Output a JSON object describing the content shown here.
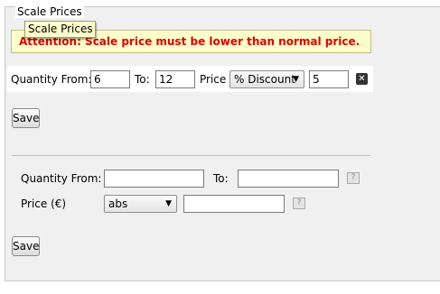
{
  "fieldset": {
    "legend": "Scale Prices"
  },
  "tooltip": {
    "text": "Scale Prices"
  },
  "alert": {
    "text": "Attention: Scale price must be lower than normal price."
  },
  "existing_row": {
    "quantity_from_label": "Quantity From:",
    "quantity_from_value": "6",
    "to_label": "To:",
    "to_value": "12",
    "price_label": "Price",
    "price_type_selected": "% Discount",
    "price_value": "5",
    "delete_icon": "close-icon"
  },
  "save_label": "Save",
  "new_entry": {
    "quantity_from_label": "Quantity From:",
    "quantity_from_value": "",
    "to_label": "To:",
    "to_value": "",
    "price_label": "Price (€)",
    "price_type_selected": "abs",
    "price_value": "",
    "help_icon_glyph": "?"
  },
  "colors": {
    "alert_text": "#e00000",
    "alert_background": "#ffffcc",
    "panel_background": "#f0f0f0"
  }
}
